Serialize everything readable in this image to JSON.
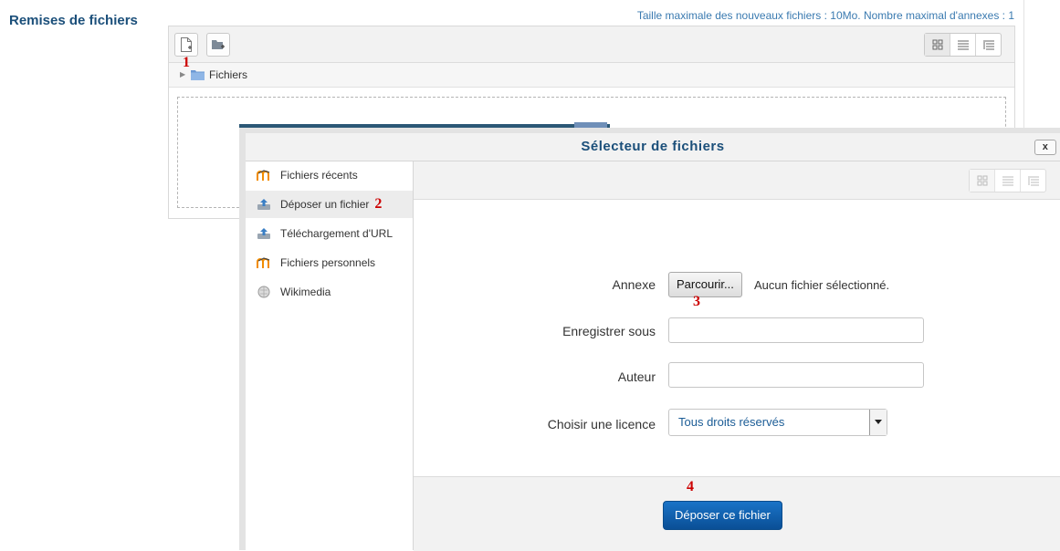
{
  "page": {
    "section_title": "Remises de fichiers",
    "limits_text": "Taille maximale des nouveaux fichiers : 10Mo. Nombre maximal d'annexes : 1"
  },
  "filemanager": {
    "path_label": "Fichiers"
  },
  "annotations": [
    "1",
    "2",
    "3",
    "4"
  ],
  "dialog": {
    "title": "Sélecteur de fichiers",
    "close_label": "x",
    "sidebar": [
      {
        "label": "Fichiers récents",
        "icon": "moodle-icon"
      },
      {
        "label": "Déposer un fichier",
        "icon": "upload-icon",
        "active": true
      },
      {
        "label": "Téléchargement d'URL",
        "icon": "url-download-icon"
      },
      {
        "label": "Fichiers personnels",
        "icon": "moodle-icon"
      },
      {
        "label": "Wikimedia",
        "icon": "wikimedia-icon"
      }
    ],
    "form": {
      "attachment_label": "Annexe",
      "browse_label": "Parcourir...",
      "no_file_text": "Aucun fichier sélectionné.",
      "save_as_label": "Enregistrer sous",
      "save_as_value": "",
      "author_label": "Auteur",
      "author_value": "",
      "license_label": "Choisir une licence",
      "license_selected": "Tous droits réservés"
    },
    "submit_label": "Déposer ce fichier"
  },
  "colors": {
    "title_blue": "#1b4f7a",
    "link_blue": "#3a7ab0",
    "button_blue": "#0f5fae",
    "annotation_red": "#cc0000"
  }
}
